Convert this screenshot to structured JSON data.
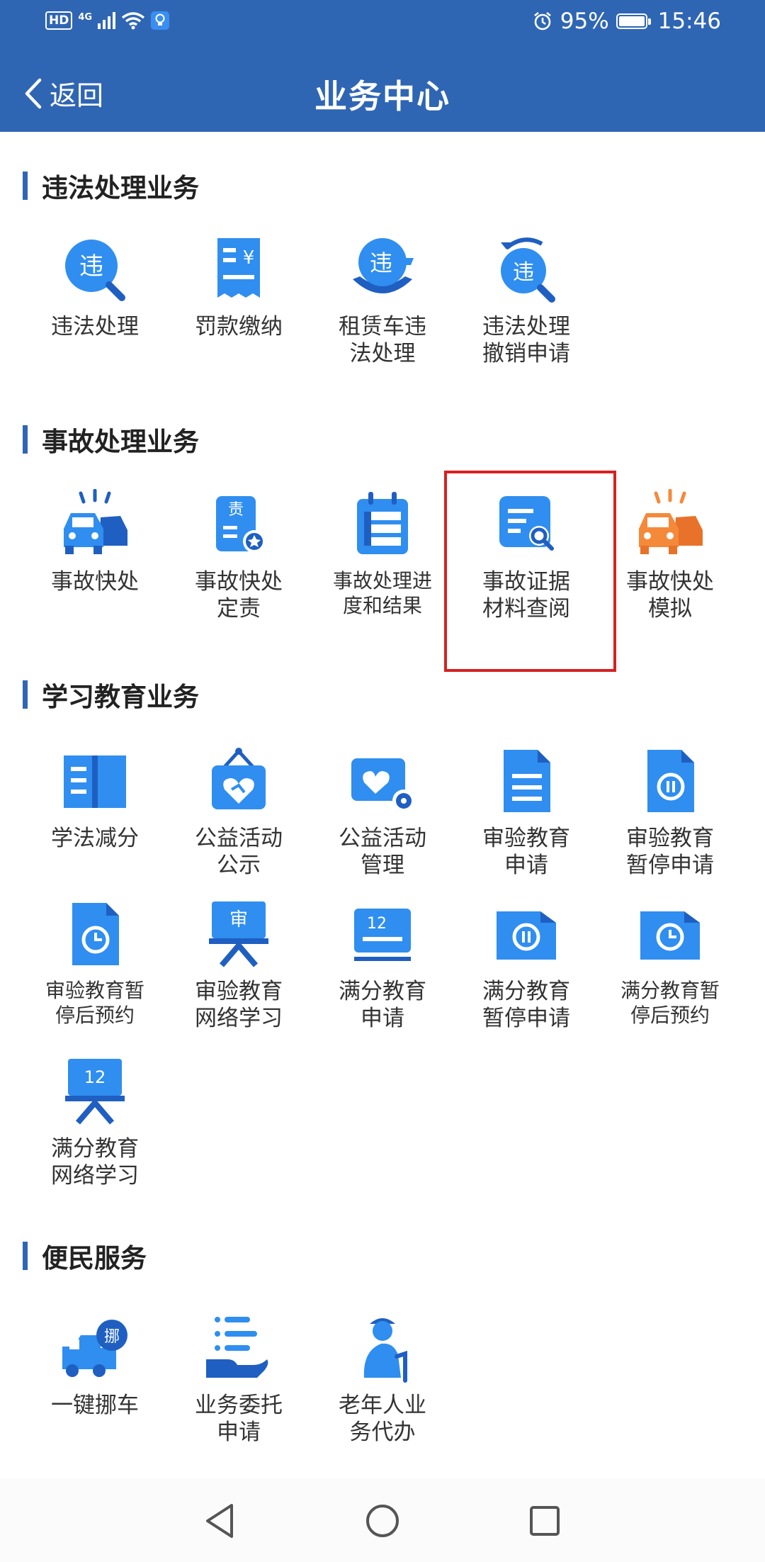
{
  "status_bar": {
    "network_label": "4G",
    "badge": "HD",
    "battery_percent": "95%",
    "time": "15:46"
  },
  "nav": {
    "back_label": "返回",
    "title": "业务中心"
  },
  "sections": [
    {
      "title": "违法处理业务",
      "items": [
        {
          "label": "违法处理",
          "icon": "violation-search-icon"
        },
        {
          "label": "罚款缴纳",
          "icon": "fine-bill-icon"
        },
        {
          "label": "租赁车违\n法处理",
          "icon": "rental-violation-icon"
        },
        {
          "label": "违法处理\n撤销申请",
          "icon": "violation-revoke-icon"
        }
      ]
    },
    {
      "title": "事故处理业务",
      "items": [
        {
          "label": "事故快处",
          "icon": "car-accident-icon"
        },
        {
          "label": "事故快处\n定责",
          "icon": "liability-doc-icon"
        },
        {
          "label": "事故处理进\n度和结果",
          "icon": "progress-calendar-icon"
        },
        {
          "label": "事故证据\n材料查阅",
          "icon": "evidence-search-icon"
        },
        {
          "label": "事故快处\n模拟",
          "icon": "accident-simulation-icon"
        }
      ]
    },
    {
      "title": "学习教育业务",
      "items": [
        {
          "label": "学法减分",
          "icon": "open-book-icon"
        },
        {
          "label": "公益活动\n公示",
          "icon": "charity-sign-icon"
        },
        {
          "label": "公益活动\n管理",
          "icon": "charity-manage-icon"
        },
        {
          "label": "审验教育\n申请",
          "icon": "document-lines-icon"
        },
        {
          "label": "审验教育\n暂停申请",
          "icon": "document-pause-icon"
        },
        {
          "label": "审验教育暂\n停后预约",
          "icon": "document-clock-icon"
        },
        {
          "label": "审验教育\n网络学习",
          "icon": "board-audit-icon"
        },
        {
          "label": "满分教育\n申请",
          "icon": "score12-doc-icon"
        },
        {
          "label": "满分教育\n暂停申请",
          "icon": "folder-pause-icon"
        },
        {
          "label": "满分教育暂\n停后预约",
          "icon": "folder-clock-icon"
        },
        {
          "label": "满分教育\n网络学习",
          "icon": "board-12-icon"
        }
      ]
    },
    {
      "title": "便民服务",
      "items": [
        {
          "label": "一键挪车",
          "icon": "move-truck-icon"
        },
        {
          "label": "业务委托\n申请",
          "icon": "delegate-hand-icon"
        },
        {
          "label": "老年人业\n务代办",
          "icon": "elderly-person-icon"
        }
      ]
    }
  ],
  "colors": {
    "header": "#2f66b4",
    "icon_blue": "#2f8ef0",
    "icon_dark": "#1f5fc2",
    "accent_orange": "#f5893a",
    "highlight": "#d72020"
  }
}
